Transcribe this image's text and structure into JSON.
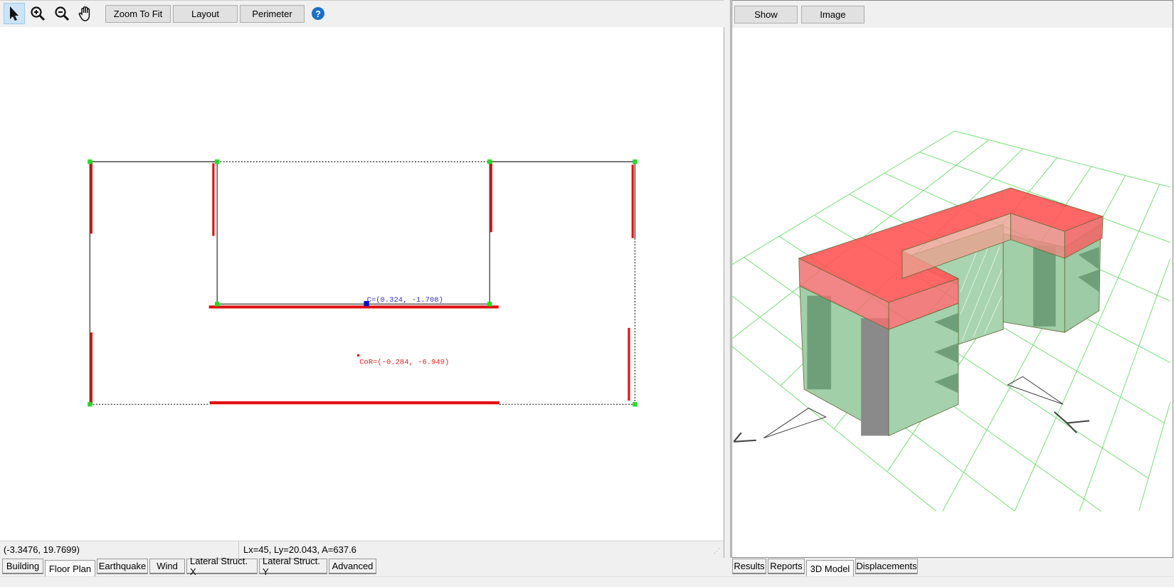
{
  "left_toolbar": {
    "tools": [
      "select-pointer",
      "zoom-in",
      "zoom-out",
      "pan-hand"
    ],
    "buttons": {
      "zoom_to_fit": "Zoom To Fit",
      "layout": "Layout",
      "perimeter": "Perimeter"
    },
    "help_icon": "?"
  },
  "floor_plan": {
    "center_of_mass_label": "C=(0.324, -1.708)",
    "center_of_rigidity_label": "CoR=(-0.284, -6.949)"
  },
  "status_bar": {
    "cursor_coords": "(-3.3476, 19.7699)",
    "dimensions": "Lx=45, Ly=20.043, A=637.6"
  },
  "left_tabs": [
    {
      "label": "Building",
      "active": false
    },
    {
      "label": "Floor Plan",
      "active": true
    },
    {
      "label": "Earthquake",
      "active": false
    },
    {
      "label": "Wind",
      "active": false
    },
    {
      "label": "Lateral Struct. X",
      "active": false
    },
    {
      "label": "Lateral Struct. Y",
      "active": false
    },
    {
      "label": "Advanced",
      "active": false
    }
  ],
  "right_toolbar": {
    "show": "Show",
    "image": "Image"
  },
  "right_tabs": [
    {
      "label": "Results",
      "active": false
    },
    {
      "label": "Reports",
      "active": false
    },
    {
      "label": "3D Model",
      "active": true
    },
    {
      "label": "Displacements",
      "active": false
    }
  ],
  "colors": {
    "wall": "#e01010",
    "node": "#22dd22",
    "center_mass": "#1010c0",
    "roof": "#ff5050",
    "facade": "#8fc89a",
    "grid": "#7de07d"
  }
}
